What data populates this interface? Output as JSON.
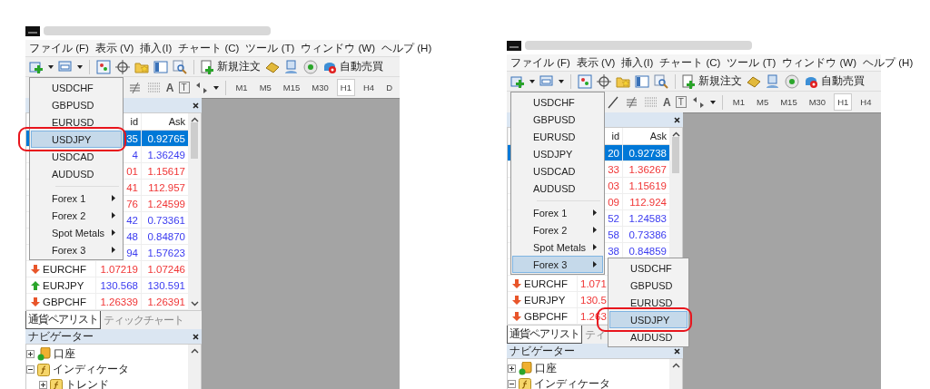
{
  "screens": [
    {
      "menu_bar": [
        "ファイル (F)",
        "表示 (V)",
        "挿入(I)",
        "チャート (C)",
        "ツール (T)",
        "ウィンドウ (W)",
        "ヘルプ (H)"
      ],
      "toolbar": {
        "order_button": "新規注文",
        "auto_trade_button": "自動売買"
      },
      "drawing_toolbar": {
        "text_tool": "A",
        "label_tool": "T",
        "timeframes": [
          {
            "label": "M1",
            "selected": false
          },
          {
            "label": "M5",
            "selected": false
          },
          {
            "label": "M15",
            "selected": false
          },
          {
            "label": "M30",
            "selected": false
          },
          {
            "label": "H1",
            "selected": true
          },
          {
            "label": "H4",
            "selected": false
          },
          {
            "label": "D",
            "selected": false
          }
        ]
      },
      "symbol_menu": {
        "annotated": true,
        "items": [
          {
            "kind": "symbol",
            "label": "USDCHF",
            "selected": false
          },
          {
            "kind": "symbol",
            "label": "GBPUSD",
            "selected": false
          },
          {
            "kind": "symbol",
            "label": "EURUSD",
            "selected": false
          },
          {
            "kind": "symbol",
            "label": "USDJPY",
            "selected": true
          },
          {
            "kind": "symbol",
            "label": "USDCAD",
            "selected": false
          },
          {
            "kind": "symbol",
            "label": "AUDUSD",
            "selected": false
          },
          {
            "kind": "separator"
          },
          {
            "kind": "submenu",
            "label": "Forex 1",
            "selected": false
          },
          {
            "kind": "submenu",
            "label": "Forex 2",
            "selected": false
          },
          {
            "kind": "submenu",
            "label": "Spot Metals",
            "selected": false
          },
          {
            "kind": "submenu",
            "label": "Forex 3",
            "selected": false
          }
        ]
      },
      "market_watch": {
        "columns": [
          "id",
          "Ask"
        ],
        "rows": [
          {
            "bid": "35",
            "ask": "0.92765",
            "rising": true,
            "selected": true
          },
          {
            "bid": "4",
            "ask": "1.36249",
            "rising": true,
            "selected": false
          },
          {
            "bid": "01",
            "ask": "1.15617",
            "rising": false,
            "selected": false
          },
          {
            "bid": "41",
            "ask": "112.957",
            "rising": false,
            "selected": false
          },
          {
            "bid": "76",
            "ask": "1.24599",
            "rising": false,
            "selected": false
          },
          {
            "bid": "42",
            "ask": "0.73361",
            "rising": true,
            "selected": false
          },
          {
            "bid": "48",
            "ask": "0.84870",
            "rising": true,
            "selected": false
          },
          {
            "bid": "94",
            "ask": "1.57623",
            "rising": true,
            "selected": false
          },
          {
            "symbol": "EURCHF",
            "bid": "1.07219",
            "ask": "1.07246",
            "rising": false,
            "selected": false
          },
          {
            "symbol": "EURJPY",
            "bid": "130.568",
            "ask": "130.591",
            "rising": true,
            "selected": false
          },
          {
            "symbol": "GBPCHF",
            "bid": "1.26339",
            "ask": "1.26391",
            "rising": false,
            "selected": false
          }
        ],
        "tabs": [
          {
            "label": "通貨ペアリスト",
            "selected": true
          },
          {
            "label": "ティックチャート",
            "selected": false
          }
        ]
      },
      "navigator": {
        "title": "ナビゲーター",
        "tree": [
          {
            "label": "口座",
            "kind": "account",
            "expanded": false
          },
          {
            "label": "インディケータ",
            "kind": "indicator",
            "expanded": true,
            "children": [
              {
                "label": "トレンド",
                "kind": "indicator",
                "expanded": false
              }
            ]
          }
        ]
      }
    },
    {
      "menu_bar": [
        "ファイル (F)",
        "表示 (V)",
        "挿入(I)",
        "チャート (C)",
        "ツール (T)",
        "ウィンドウ (W)",
        "ヘルプ (H)"
      ],
      "toolbar": {
        "order_button": "新規注文",
        "auto_trade_button": "自動売買"
      },
      "drawing_toolbar": {
        "text_tool": "A",
        "label_tool": "T",
        "timeframes": [
          {
            "label": "M1",
            "selected": false
          },
          {
            "label": "M5",
            "selected": false
          },
          {
            "label": "M15",
            "selected": false
          },
          {
            "label": "M30",
            "selected": false
          },
          {
            "label": "H1",
            "selected": true
          },
          {
            "label": "H4",
            "selected": false
          }
        ]
      },
      "symbol_menu": {
        "annotated": false,
        "items": [
          {
            "kind": "symbol",
            "label": "USDCHF",
            "selected": false
          },
          {
            "kind": "symbol",
            "label": "GBPUSD",
            "selected": false
          },
          {
            "kind": "symbol",
            "label": "EURUSD",
            "selected": false
          },
          {
            "kind": "symbol",
            "label": "USDJPY",
            "selected": false
          },
          {
            "kind": "symbol",
            "label": "USDCAD",
            "selected": false
          },
          {
            "kind": "symbol",
            "label": "AUDUSD",
            "selected": false
          },
          {
            "kind": "separator"
          },
          {
            "kind": "submenu",
            "label": "Forex 1",
            "selected": false
          },
          {
            "kind": "submenu",
            "label": "Forex 2",
            "selected": false
          },
          {
            "kind": "submenu",
            "label": "Spot Metals",
            "selected": false
          },
          {
            "kind": "submenu",
            "label": "Forex 3",
            "selected": true,
            "submenu": {
              "annotated": true,
              "items": [
                {
                  "kind": "symbol",
                  "label": "USDCHF",
                  "selected": false
                },
                {
                  "kind": "symbol",
                  "label": "GBPUSD",
                  "selected": false
                },
                {
                  "kind": "symbol",
                  "label": "EURUSD",
                  "selected": false
                },
                {
                  "kind": "symbol",
                  "label": "USDJPY",
                  "selected": true
                },
                {
                  "kind": "symbol",
                  "label": "AUDUSD",
                  "selected": false
                }
              ]
            }
          }
        ]
      },
      "market_watch": {
        "columns": [
          "id",
          "Ask"
        ],
        "rows": [
          {
            "bid": "20",
            "ask": "0.92738",
            "rising": true,
            "selected": true
          },
          {
            "bid": "33",
            "ask": "1.36267",
            "rising": false,
            "selected": false
          },
          {
            "bid": "03",
            "ask": "1.15619",
            "rising": false,
            "selected": false
          },
          {
            "bid": "09",
            "ask": "112.924",
            "rising": false,
            "selected": false
          },
          {
            "bid": "52",
            "ask": "1.24583",
            "rising": true,
            "selected": false
          },
          {
            "bid": "58",
            "ask": "0.73386",
            "rising": true,
            "selected": false
          },
          {
            "bid": "38",
            "ask": "0.84859",
            "rising": true,
            "selected": false
          },
          {
            "selected": false
          },
          {
            "symbol": "EURCHF",
            "bid": "1.071",
            "rising": false,
            "selected": false
          },
          {
            "symbol": "EURJPY",
            "bid": "130.5",
            "rising": false,
            "selected": false
          },
          {
            "symbol": "GBPCHF",
            "bid": "1.263",
            "rising": false,
            "selected": false
          }
        ],
        "tabs": [
          {
            "label": "通貨ペアリスト",
            "selected": true
          },
          {
            "label": "ティ",
            "selected": false
          }
        ]
      },
      "navigator": {
        "title": "ナビゲーター",
        "tree": [
          {
            "label": "口座",
            "kind": "account",
            "expanded": false
          },
          {
            "label": "インディケータ",
            "kind": "indicator",
            "expanded": true
          }
        ]
      }
    }
  ]
}
